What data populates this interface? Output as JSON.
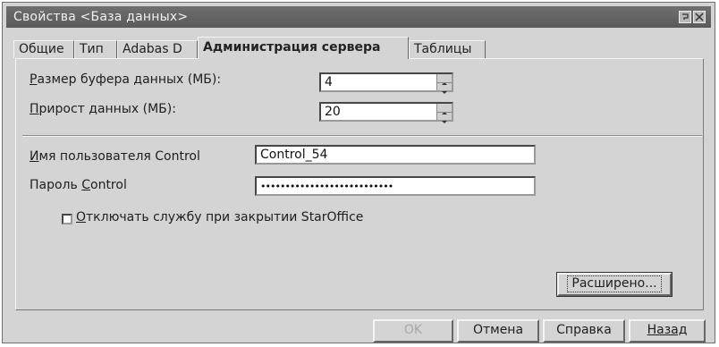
{
  "window": {
    "title": "Свойства <База данных>"
  },
  "tabs": [
    {
      "label": "Общие",
      "active": false
    },
    {
      "label": "Тип",
      "active": false
    },
    {
      "label": "Adabas D",
      "active": false
    },
    {
      "label": "Администрация сервера",
      "active": true
    },
    {
      "label": "Таблицы",
      "active": false
    }
  ],
  "fields": {
    "buffer_size": {
      "label_mnemonic": "Р",
      "label_rest": "азмер буфера данных (МБ):",
      "value": "4"
    },
    "data_increment": {
      "label_mnemonic": "П",
      "label_rest": "рирост данных (МБ):",
      "value": "20"
    },
    "control_user": {
      "label_mnemonic": "И",
      "label_rest": "мя пользователя Control",
      "value": "Control_54"
    },
    "control_password": {
      "label_prefix": "Пароль ",
      "label_mnemonic": "C",
      "label_rest": "ontrol",
      "value": "•••••••••••••••••••••••••••"
    },
    "shutdown_checkbox": {
      "label_mnemonic": "О",
      "label_rest": "тключать службу при закрытии StarOffice",
      "checked": false
    }
  },
  "buttons": {
    "advanced": "Расширено...",
    "ok": "OK",
    "cancel": "Отмена",
    "help": "Справка",
    "back": "Назад"
  },
  "colors": {
    "titlebar": "#5f5f5f",
    "dialog_bg": "#d4d4d4"
  }
}
